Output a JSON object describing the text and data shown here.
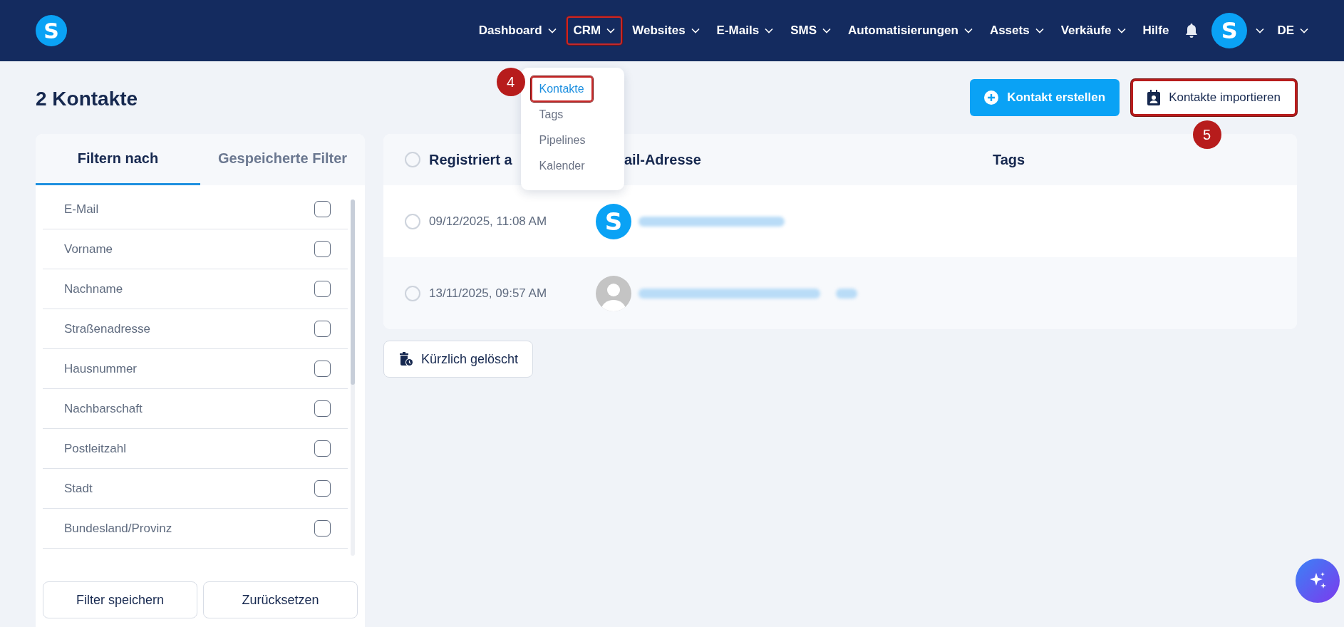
{
  "logo": {
    "letter": "S"
  },
  "nav": {
    "items": [
      {
        "label": "Dashboard",
        "dropdown": true,
        "highlighted": false
      },
      {
        "label": "CRM",
        "dropdown": true,
        "highlighted": true
      },
      {
        "label": "Websites",
        "dropdown": true,
        "highlighted": false
      },
      {
        "label": "E-Mails",
        "dropdown": true,
        "highlighted": false
      },
      {
        "label": "SMS",
        "dropdown": true,
        "highlighted": false
      },
      {
        "label": "Automatisierungen",
        "dropdown": true,
        "highlighted": false
      },
      {
        "label": "Assets",
        "dropdown": true,
        "highlighted": false
      },
      {
        "label": "Verkäufe",
        "dropdown": true,
        "highlighted": false
      },
      {
        "label": "Hilfe",
        "dropdown": false,
        "highlighted": false
      }
    ],
    "avatar": "S",
    "language": "DE"
  },
  "crm_menu": {
    "step": "4",
    "items": [
      {
        "label": "Kontakte",
        "selected": true,
        "highlighted": true
      },
      {
        "label": "Tags",
        "selected": false,
        "highlighted": false
      },
      {
        "label": "Pipelines",
        "selected": false,
        "highlighted": false
      },
      {
        "label": "Kalender",
        "selected": false,
        "highlighted": false
      }
    ]
  },
  "page_title": "2 Kontakte",
  "actions": [
    {
      "label": "Kontakt erstellen",
      "kind": "primary",
      "highlighted": false
    },
    {
      "label": "Kontakte importieren",
      "kind": "import",
      "highlighted": true,
      "step": "5"
    }
  ],
  "filter_panel": {
    "tabs": [
      {
        "label": "Filtern nach",
        "selected": true
      },
      {
        "label": "Gespeicherte Filter",
        "selected": false
      }
    ],
    "fields": [
      {
        "label": "E-Mail",
        "checked": false
      },
      {
        "label": "Vorname",
        "checked": false
      },
      {
        "label": "Nachname",
        "checked": false
      },
      {
        "label": "Straßenadresse",
        "checked": false
      },
      {
        "label": "Hausnummer",
        "checked": false
      },
      {
        "label": "Nachbarschaft",
        "checked": false
      },
      {
        "label": "Postleitzahl",
        "checked": false
      },
      {
        "label": "Stadt",
        "checked": false
      },
      {
        "label": "Bundesland/Provinz",
        "checked": false
      }
    ],
    "buttons": [
      "Filter speichern",
      "Zurücksetzen"
    ]
  },
  "table": {
    "select_all": {
      "selected": false
    },
    "columns": [
      "Registriert a",
      "ail-Adresse",
      "Tags"
    ],
    "rows": [
      {
        "selected": false,
        "registered": "09/12/2025, 11:08 AM",
        "avatar": {
          "kind": "letter",
          "letter": "S"
        }
      },
      {
        "selected": false,
        "registered": "13/11/2025, 09:57 AM",
        "avatar": {
          "kind": "default"
        }
      }
    ]
  },
  "deleted_button": "Kürzlich gelöscht"
}
